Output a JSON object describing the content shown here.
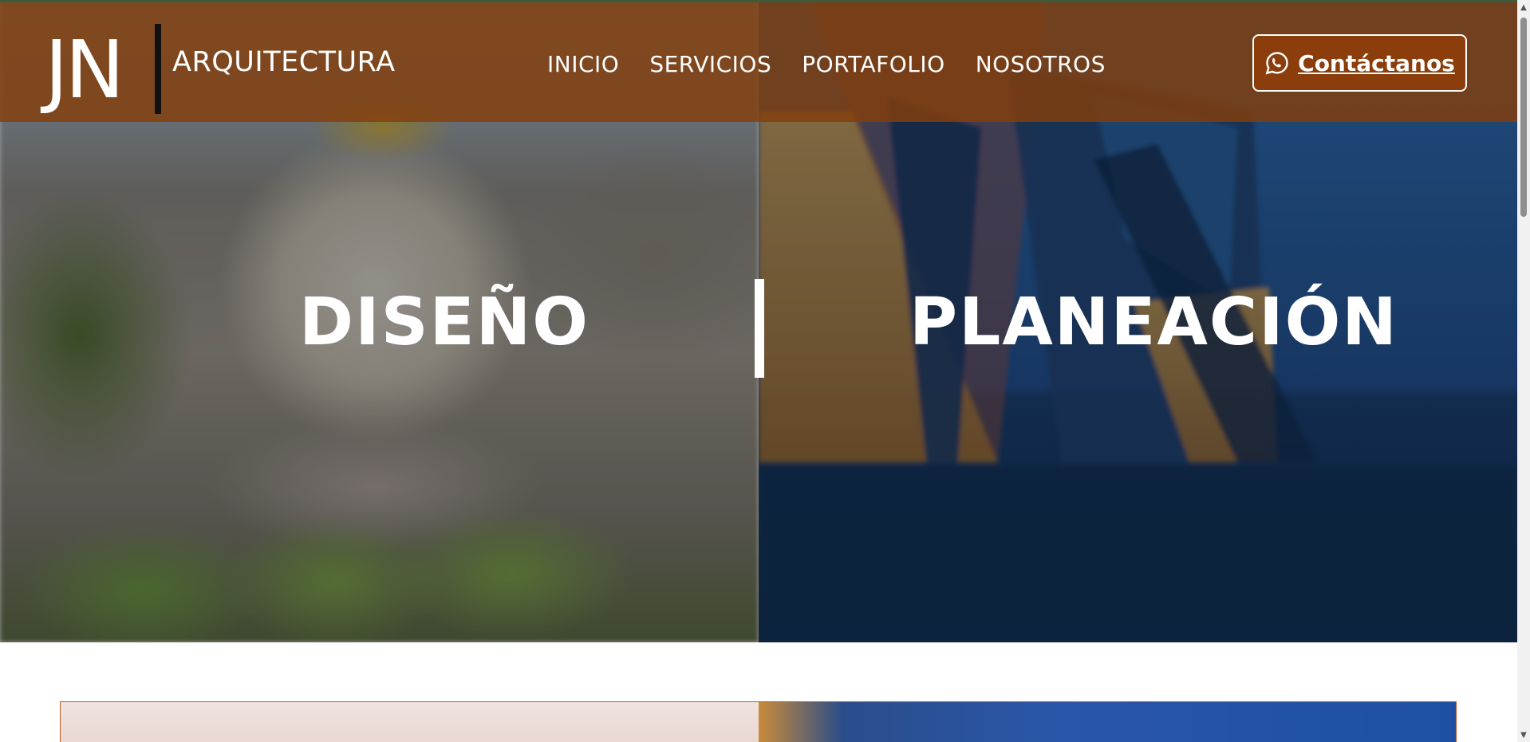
{
  "brand": {
    "logo_mark": "JN",
    "name": "ARQUITECTURA"
  },
  "nav": {
    "items": [
      {
        "label": "INICIO"
      },
      {
        "label": "SERVICIOS"
      },
      {
        "label": "PORTAFOLIO"
      },
      {
        "label": "NOSOTROS"
      }
    ]
  },
  "cta": {
    "label": "Contáctanos",
    "icon": "whatsapp-icon"
  },
  "hero": {
    "left_word": "DISEÑO",
    "right_word": "PLANEACIÓN"
  },
  "colors": {
    "header_brown": "#843e0b",
    "cta_brown": "#8b3e0c",
    "accent_green": "#3f5a3a",
    "white": "#ffffff"
  }
}
